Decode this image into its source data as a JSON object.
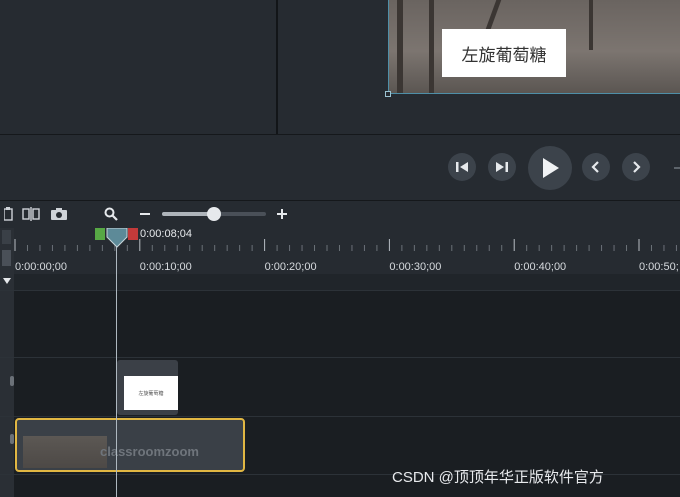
{
  "preview": {
    "caption_text": "左旋葡萄糖"
  },
  "caption_clip": {
    "thumb_text": "左旋葡萄糖"
  },
  "controls": {
    "icons": [
      "step-back-icon",
      "step-forward-icon",
      "play-icon",
      "prev-marker-icon",
      "next-marker-icon"
    ]
  },
  "toolbar": {
    "icons": [
      "split-icon",
      "snapshot-icon",
      "search-icon",
      "zoom-out-icon",
      "zoom-in-icon"
    ],
    "zoom_level": 0.5
  },
  "timeline": {
    "playhead_time": "0:00:08;04",
    "ruler_labels": [
      "0:00:00;00",
      "0:00:10;00",
      "0:00:20;00",
      "0:00:30;00",
      "0:00:40;00",
      "0:00:50;"
    ]
  },
  "video_clip": {
    "label": "classroomzoom"
  },
  "watermark": {
    "text": "CSDN @顶顶年华正版软件官方"
  },
  "colors": {
    "accent_selection": "#e1b743",
    "in_marker": "#57a845",
    "out_marker": "#c23a3a",
    "canvas_border": "#4e8fa8"
  }
}
